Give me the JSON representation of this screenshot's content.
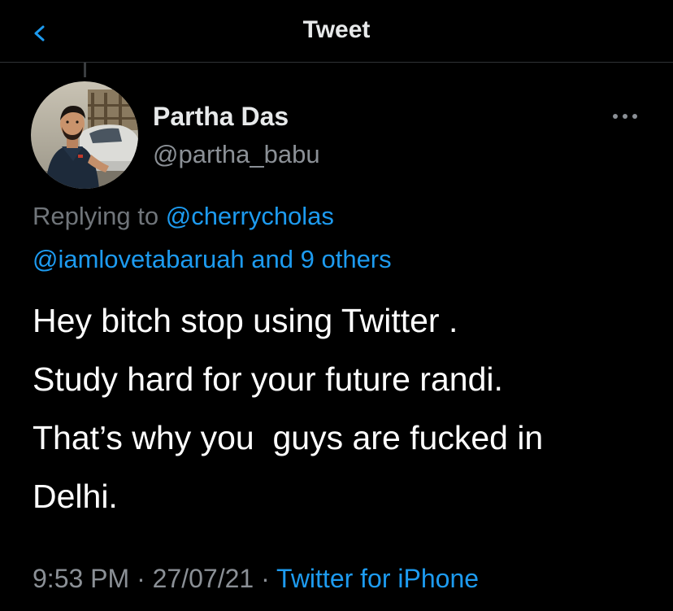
{
  "header": {
    "title": "Tweet",
    "back_icon": "chevron-left-icon"
  },
  "author": {
    "display_name": "Partha Das",
    "handle": "@partha_babu",
    "avatar": "profile-photo"
  },
  "more_icon": "more-horizontal-icon",
  "reply": {
    "prefix": "Replying to ",
    "mention_1": "@cherrycholas",
    "mention_2": "@iamlovetabaruah",
    "and_others": " and 9 others"
  },
  "tweet": {
    "lines": [
      "Hey bitch stop using Twitter .",
      "Study hard for your future randi.",
      "That’s why you  guys are fucked in",
      "Delhi."
    ]
  },
  "meta": {
    "time": "9:53 PM",
    "sep1": " · ",
    "date": "27/07/21",
    "sep2": " · ",
    "source": "Twitter for iPhone"
  },
  "colors": {
    "background": "#000000",
    "text": "#ffffff",
    "muted": "#8b9096",
    "link": "#1d9bf0"
  }
}
